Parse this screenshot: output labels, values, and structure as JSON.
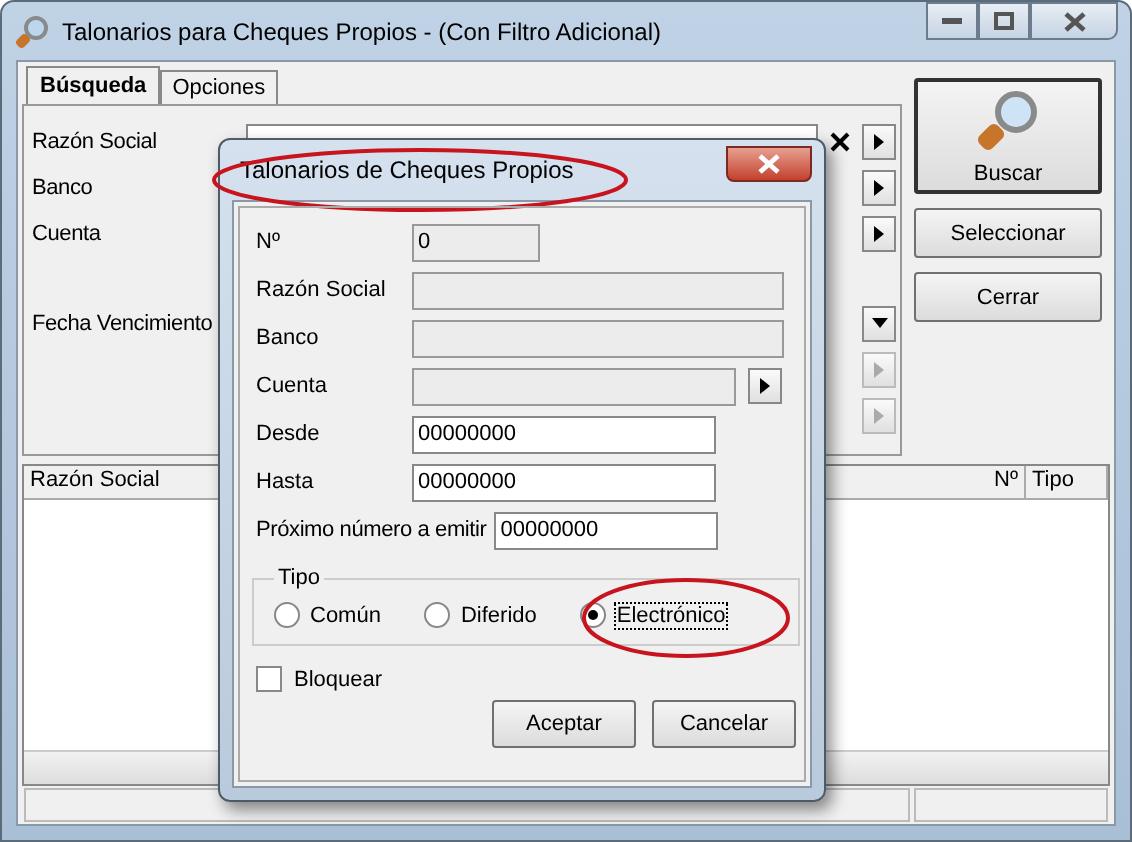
{
  "window": {
    "title": "Talonarios para Cheques Propios - (Con Filtro Adicional)"
  },
  "tabs": [
    {
      "label": "Búsqueda",
      "selected": true
    },
    {
      "label": "Opciones",
      "selected": false
    }
  ],
  "filters": [
    {
      "label": "Razón Social",
      "kind": "clearable"
    },
    {
      "label": "Banco",
      "kind": "lookup"
    },
    {
      "label": "Cuenta",
      "kind": "lookup"
    },
    {
      "label": "Fecha Vencimiento",
      "kind": "date"
    },
    {
      "kind": "disabled"
    },
    {
      "kind": "disabled"
    }
  ],
  "action_buttons": [
    {
      "label": "Buscar",
      "kind": "icon"
    },
    {
      "label": "Seleccionar",
      "kind": "plain"
    },
    {
      "label": "Cerrar",
      "kind": "plain"
    }
  ],
  "grid": {
    "columns": [
      "Razón Social",
      "Nº",
      "Tipo"
    ]
  },
  "dialog": {
    "title": "Talonarios de Cheques Propios",
    "fields": [
      {
        "label": "Nº",
        "value": "0",
        "disabled": true,
        "kind": "short"
      },
      {
        "label": "Razón Social",
        "disabled": true,
        "kind": "wide"
      },
      {
        "label": "Banco",
        "disabled": true,
        "kind": "wide"
      },
      {
        "label": "Cuenta",
        "disabled": true,
        "kind": "lookup"
      },
      {
        "label": "Desde",
        "value": "00000000",
        "disabled": false,
        "kind": "medium"
      },
      {
        "label": "Hasta",
        "value": "00000000",
        "disabled": false,
        "kind": "medium"
      },
      {
        "label": "Próximo número a emitir",
        "value": "00000000",
        "disabled": false,
        "kind": "inline"
      }
    ],
    "type_group": {
      "label": "Tipo",
      "options": [
        {
          "label": "Común",
          "selected": false
        },
        {
          "label": "Diferido",
          "selected": false
        },
        {
          "label": "Electrónico",
          "selected": true
        }
      ]
    },
    "lock": {
      "label": "Bloquear",
      "checked": false
    },
    "buttons": [
      "Aceptar",
      "Cancelar"
    ]
  }
}
